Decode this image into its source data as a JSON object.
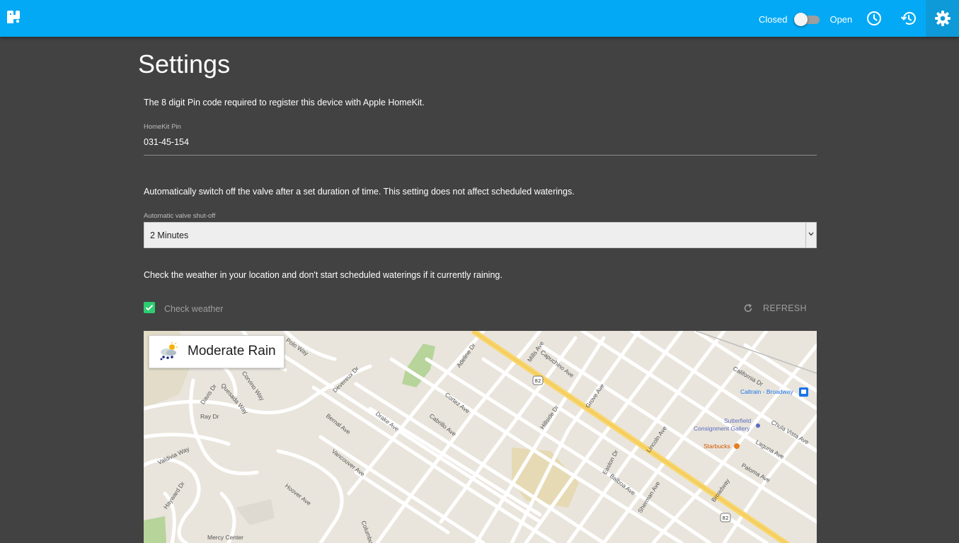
{
  "header": {
    "toggle_closed_label": "Closed",
    "toggle_open_label": "Open",
    "toggle_state": "closed",
    "icons": [
      "logo-icon",
      "clock-icon",
      "history-icon",
      "gear-icon"
    ],
    "accent_color": "#03a9f4"
  },
  "page": {
    "title": "Settings"
  },
  "homekit": {
    "description": "The 8 digit Pin code required to register this device with Apple HomeKit.",
    "pin_label": "HomeKit Pin",
    "pin_value": "031-45-154"
  },
  "shutoff": {
    "description": "Automatically switch off the valve after a set duration of time. This setting does not affect scheduled waterings.",
    "label": "Automatic valve shut-off",
    "selected": "2 Minutes"
  },
  "weather": {
    "description": "Check the weather in your location and don't start scheduled waterings if it currently raining.",
    "check_label": "Check weather",
    "checked": true,
    "refresh_label": "REFRESH",
    "condition": "Moderate Rain"
  },
  "map": {
    "labels": [
      "Polo Way",
      "Corvino Way",
      "Devereux Dr",
      "Davis Dr",
      "Quesada Way",
      "Ray Dr",
      "Adeline Dr",
      "Mills Ave",
      "Capuchino Ave",
      "Grove Ave",
      "Cortez Ave",
      "Cabrillo Ave",
      "Bernal Ave",
      "Drake Ave",
      "Vancouver Ave",
      "Valdivia Way",
      "Hayward Dr",
      "Hoover Ave",
      "Hillside Dr",
      "Easton Dr",
      "Balboa Ave",
      "Sherman Ave",
      "Lincoln Ave",
      "California Dr",
      "Caltrain - Broadway",
      "Sutterfield",
      "Consignment Gallery",
      "Starbucks",
      "Chula Vista Ave",
      "Laguna Ave",
      "Paloma Ave",
      "Broadway",
      "Mercy Center",
      "Columbus",
      "82"
    ]
  }
}
